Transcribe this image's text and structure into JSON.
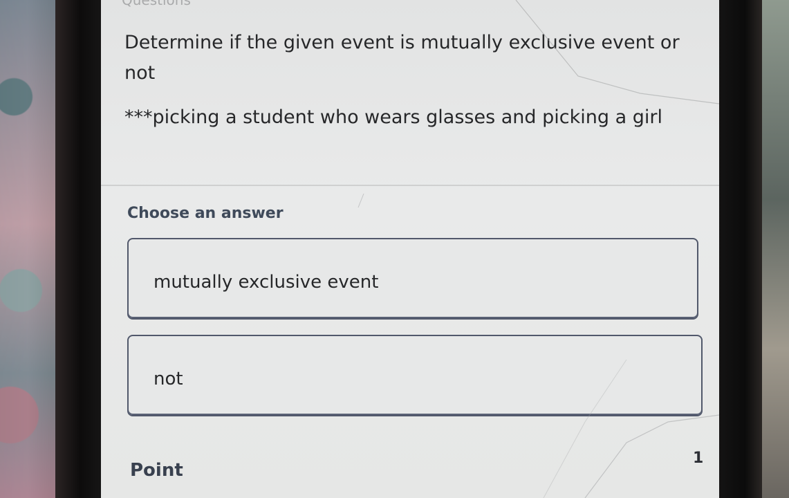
{
  "header": {
    "faded_title": "Questions"
  },
  "question": {
    "prompt": "Determine if the given event is mutually exclusive event or not",
    "event": "***picking a student who wears glasses and picking a girl"
  },
  "answers": {
    "label": "Choose an answer",
    "options": [
      {
        "label": "mutually exclusive event"
      },
      {
        "label": "not"
      }
    ]
  },
  "footer": {
    "point_label": "Point",
    "point_value": "1"
  },
  "colors": {
    "screen_bg": "#e6e7e6",
    "option_border": "#51586b",
    "text_dark": "#262729",
    "label_color": "#3f4a5a"
  }
}
